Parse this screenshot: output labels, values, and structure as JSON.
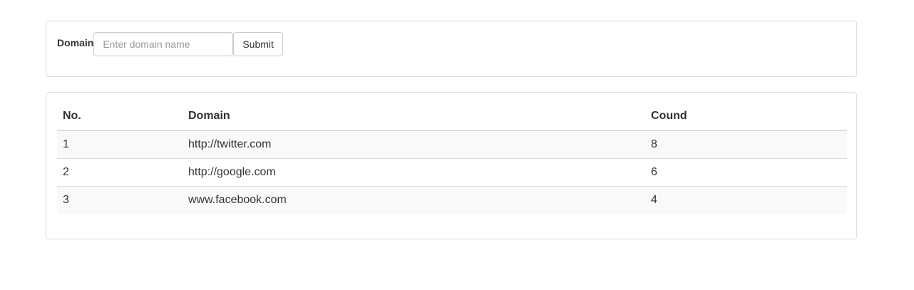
{
  "form": {
    "label": "Domain",
    "input_value": "",
    "input_placeholder": "Enter domain name",
    "submit_label": "Submit"
  },
  "table": {
    "headers": [
      "No.",
      "Domain",
      "Cound"
    ],
    "rows": [
      [
        "1",
        "http://twitter.com",
        "8"
      ],
      [
        "2",
        "http://google.com",
        "6"
      ],
      [
        "3",
        "www.facebook.com",
        "4"
      ]
    ]
  }
}
